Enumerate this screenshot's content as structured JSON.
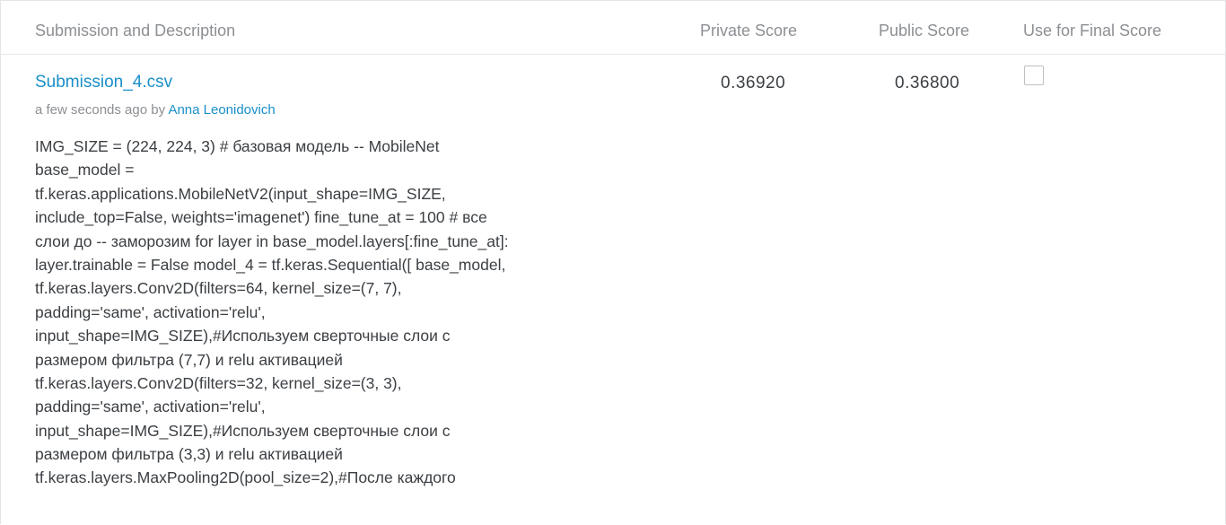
{
  "table": {
    "headers": {
      "description": "Submission and Description",
      "private_score": "Private Score",
      "public_score": "Public Score",
      "final_score": "Use for Final Score"
    }
  },
  "submission": {
    "filename": "Submission_4.csv",
    "time": "a few seconds ago by ",
    "author": "Anna Leonidovich",
    "private_score": "0.36920",
    "public_score": "0.36800",
    "use_for_final": false,
    "description_lines": [
      "IMG_SIZE = (224, 224, 3) # базовая модель -- MobileNet",
      "base_model =",
      "tf.keras.applications.MobileNetV2(input_shape=IMG_SIZE,",
      "include_top=False, weights='imagenet') fine_tune_at = 100 # все",
      "слои до -- заморозим for layer in base_model.layers[:fine_tune_at]:",
      "layer.trainable = False model_4 = tf.keras.Sequential([ base_model,",
      "tf.keras.layers.Conv2D(filters=64, kernel_size=(7, 7),",
      "padding='same', activation='relu',",
      "input_shape=IMG_SIZE),#Используем сверточные слои с",
      "размером фильтра (7,7) и relu активацией",
      "tf.keras.layers.Conv2D(filters=32, kernel_size=(3, 3),",
      "padding='same', activation='relu',",
      "input_shape=IMG_SIZE),#Используем сверточные слои с",
      "размером фильтра (3,3) и relu активацией",
      "tf.keras.layers.MaxPooling2D(pool_size=2),#После каждого"
    ]
  }
}
